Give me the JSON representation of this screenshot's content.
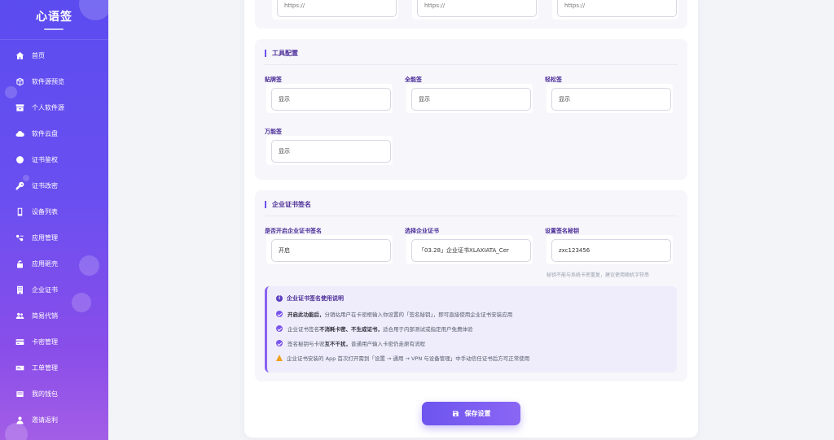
{
  "app": {
    "title": "心语签"
  },
  "sidebar": {
    "items": [
      {
        "label": "首页",
        "icon": "home-icon"
      },
      {
        "label": "软件源预览",
        "icon": "cube-icon"
      },
      {
        "label": "个人软件源",
        "icon": "archive-icon"
      },
      {
        "label": "软件云盘",
        "icon": "cloud-icon"
      },
      {
        "label": "证书鉴权",
        "icon": "certificate-icon"
      },
      {
        "label": "证书改密",
        "icon": "key-icon"
      },
      {
        "label": "设备列表",
        "icon": "mobile-icon"
      },
      {
        "label": "应用管理",
        "icon": "apps-icon"
      },
      {
        "label": "应用砸壳",
        "icon": "unlock-icon"
      },
      {
        "label": "企业证书",
        "icon": "building-icon"
      },
      {
        "label": "简易代销",
        "icon": "users-icon"
      },
      {
        "label": "卡密管理",
        "icon": "credit-card-icon"
      },
      {
        "label": "工单管理",
        "icon": "ticket-icon"
      },
      {
        "label": "我的钱包",
        "icon": "wallet-icon"
      },
      {
        "label": "邀请返利",
        "icon": "user-plus-icon"
      }
    ]
  },
  "top_section": {
    "fields": [
      {
        "placeholder": "https://"
      },
      {
        "placeholder": "https://"
      },
      {
        "placeholder": "https://"
      }
    ]
  },
  "tools": {
    "title": "工具配置",
    "fields": [
      {
        "label": "贴牌签",
        "value": "显示"
      },
      {
        "label": "全能签",
        "value": "显示"
      },
      {
        "label": "轻松签",
        "value": "显示"
      },
      {
        "label": "万能签",
        "value": "显示"
      }
    ]
  },
  "enterprise": {
    "title": "企业证书签名",
    "fields": [
      {
        "label": "是否开启企业证书签名",
        "value": "开启"
      },
      {
        "label": "选择企业证书",
        "value": "「03.28」企业证书XLAXIATA_Cer"
      },
      {
        "label": "设置签名秘钥",
        "value": "zxc123456"
      }
    ],
    "key_hint": "秘钥不能与系统卡密重复，建议使用随机字符串",
    "notes": {
      "title": "企业证书签名使用说明",
      "items": [
        {
          "bold": "开启此功能后，",
          "text": "分销站用户在卡密框输入你设置的「签名秘钥」，即可直接使用企业证书安装应用",
          "type": "check"
        },
        {
          "pre": "企业证书签名",
          "bold": "不消耗卡密、不生成证书，",
          "text": "适合用于内部测试或指定用户免费体验",
          "type": "check"
        },
        {
          "pre": "签名秘钥与卡密",
          "bold": "互不干扰，",
          "text": "普通用户输入卡密仍走原有流程",
          "type": "check"
        },
        {
          "text": "企业证书安装的 App 首次打开需到「设置 → 通用 → VPN 与设备管理」中手动信任证书后方可正常使用",
          "type": "warning"
        }
      ]
    }
  },
  "actions": {
    "save_label": "保存设置"
  },
  "colors": {
    "accent": "#6d55ef",
    "sidebar_top": "#5b4cf0",
    "sidebar_bottom": "#a35ee6",
    "title": "#4b2d98",
    "warning": "#f0a020"
  }
}
